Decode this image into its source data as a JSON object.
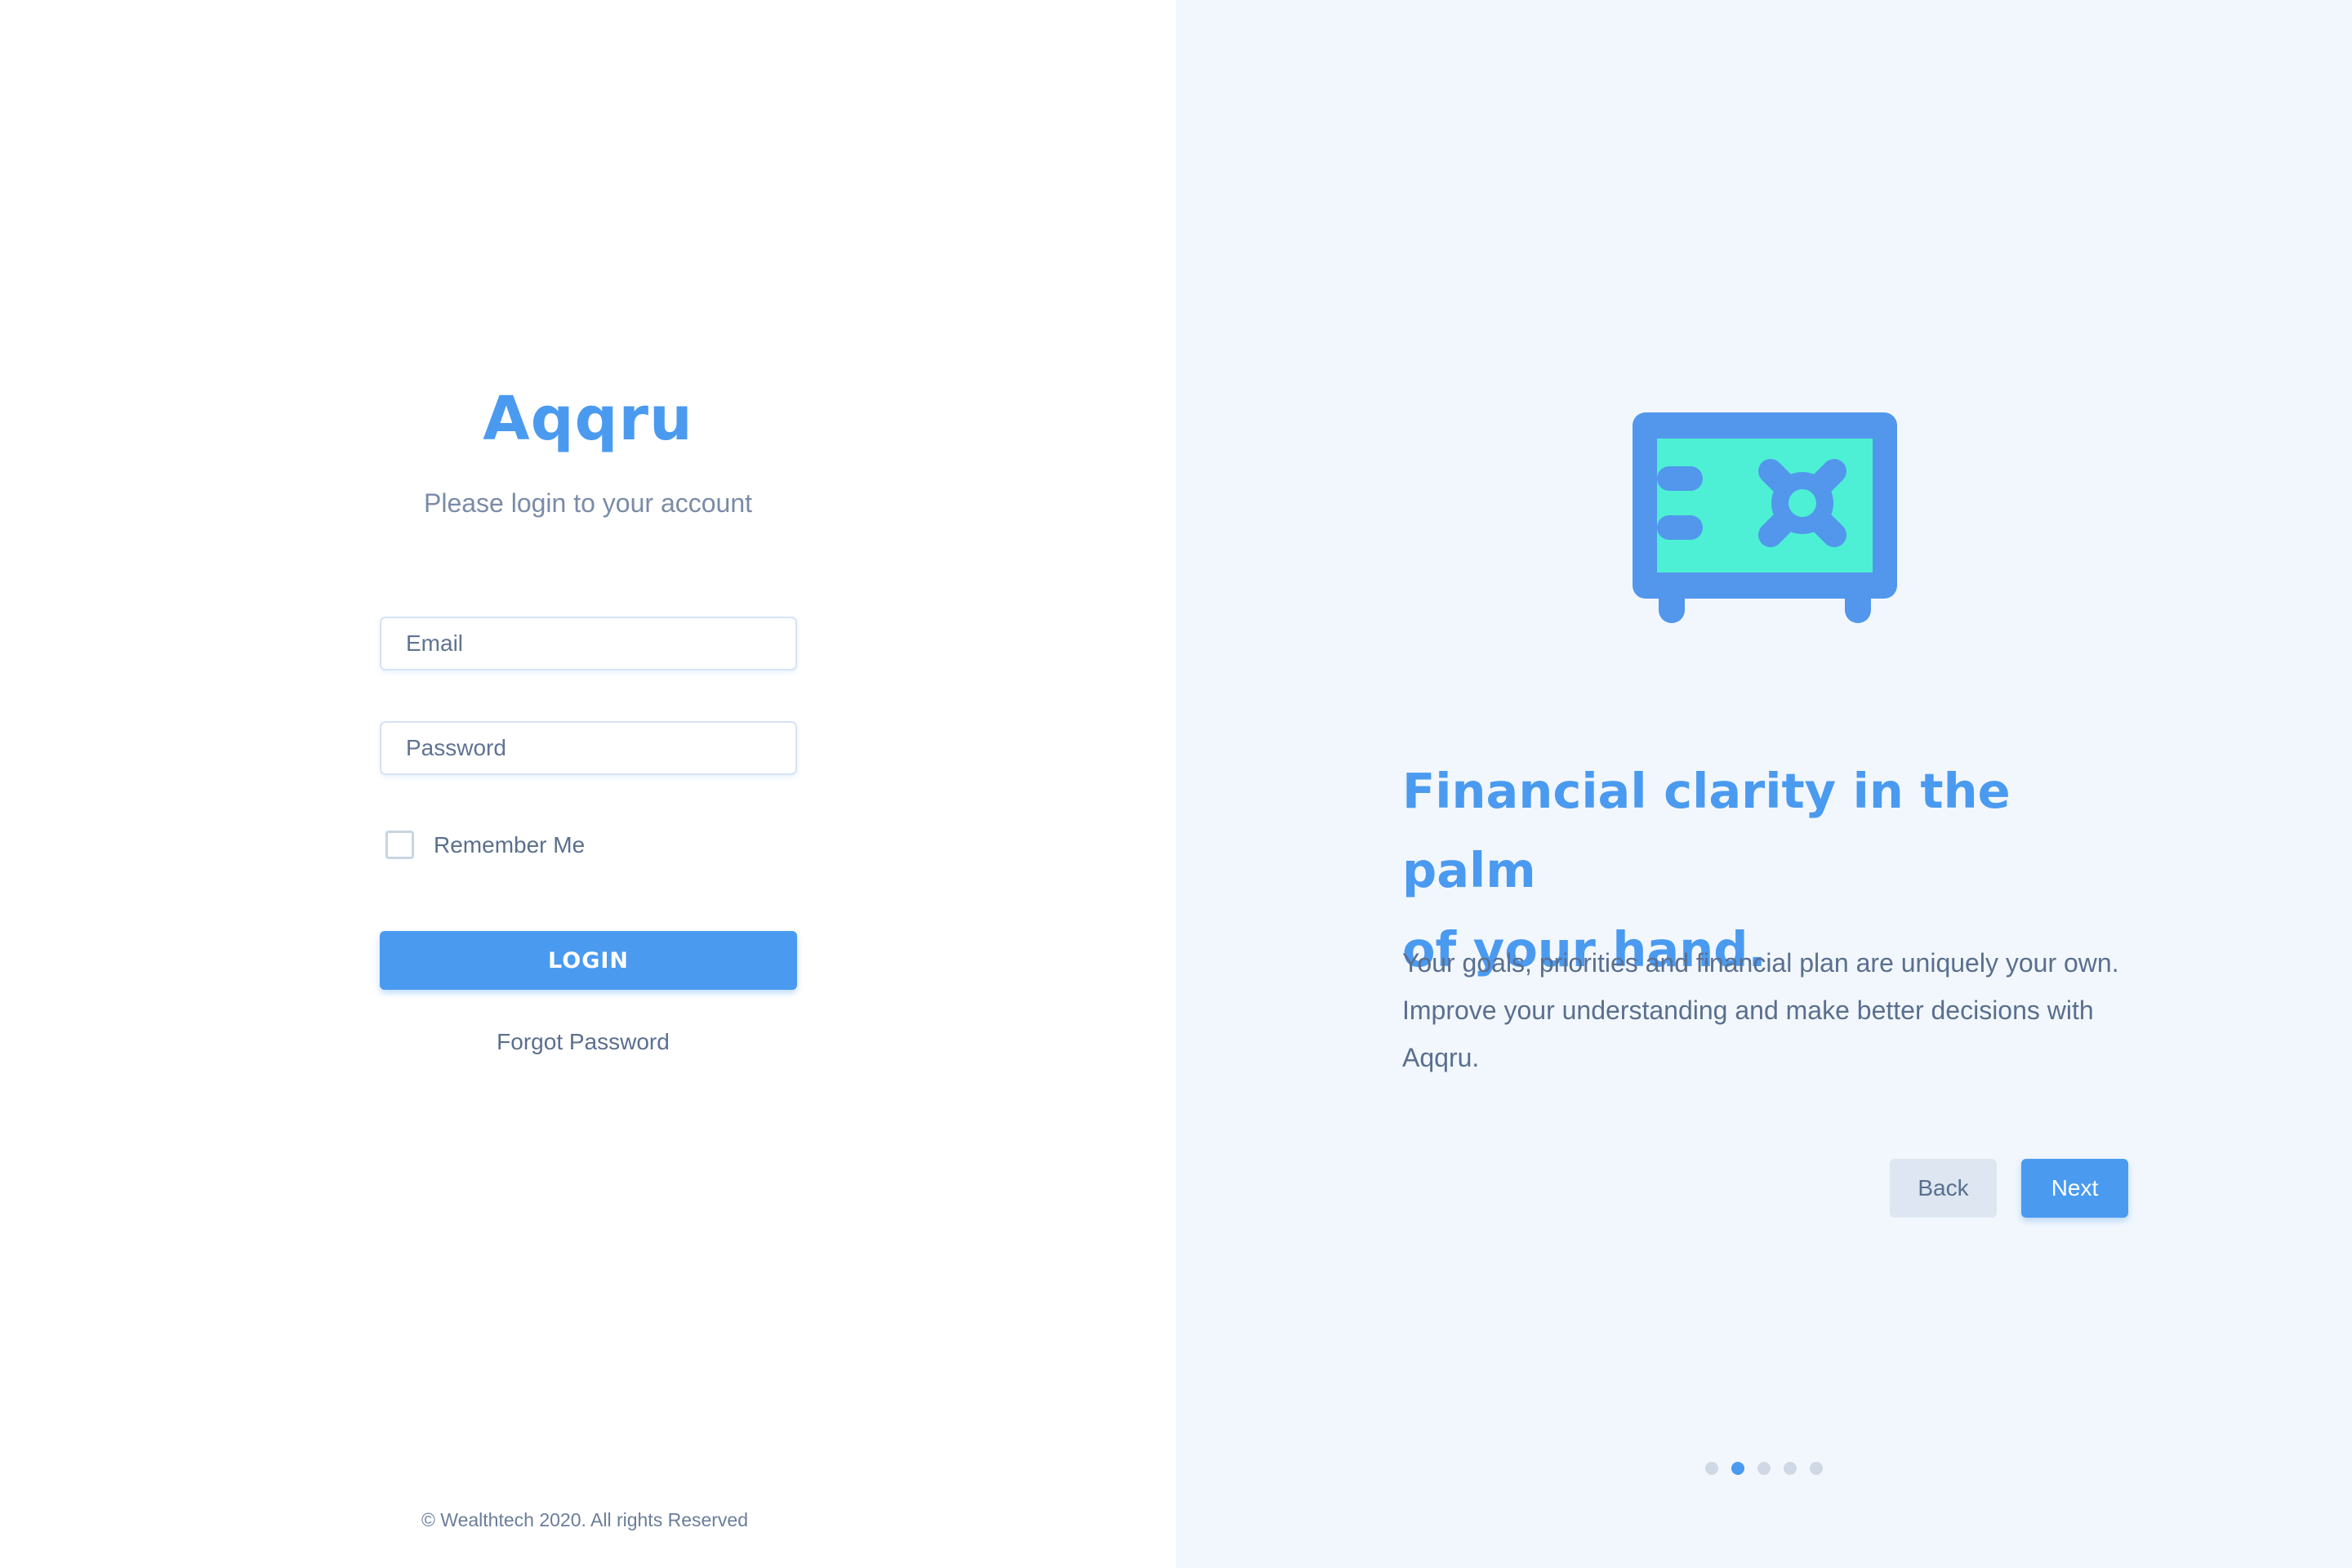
{
  "login": {
    "brand": "Aqqru",
    "subtitle": "Please login to your account",
    "email_placeholder": "Email",
    "password_placeholder": "Password",
    "remember_label": "Remember Me",
    "remember_checked": false,
    "login_label": "LOGIN",
    "forgot_label": "Forgot Password",
    "footer": "© Wealthtech 2020. All rights Reserved"
  },
  "onboarding": {
    "illustration_icon": "safe-vault-icon",
    "headline_line1": "Financial clarity in the palm",
    "headline_line2": "of your hand.",
    "description_line1": "Your goals, priorities and financial plan are uniquely your own.",
    "description_line2": "Improve your understanding and make better decisions with Aqqru.",
    "back_label": "Back",
    "next_label": "Next",
    "pagination": {
      "total": 5,
      "active_index": 1
    }
  },
  "colors": {
    "accent": "#4a9af0",
    "safe_body": "#5297ec",
    "safe_panel": "#4df0d4",
    "right_bg": "#f2f7fd",
    "text_muted": "#5a6f8e"
  }
}
